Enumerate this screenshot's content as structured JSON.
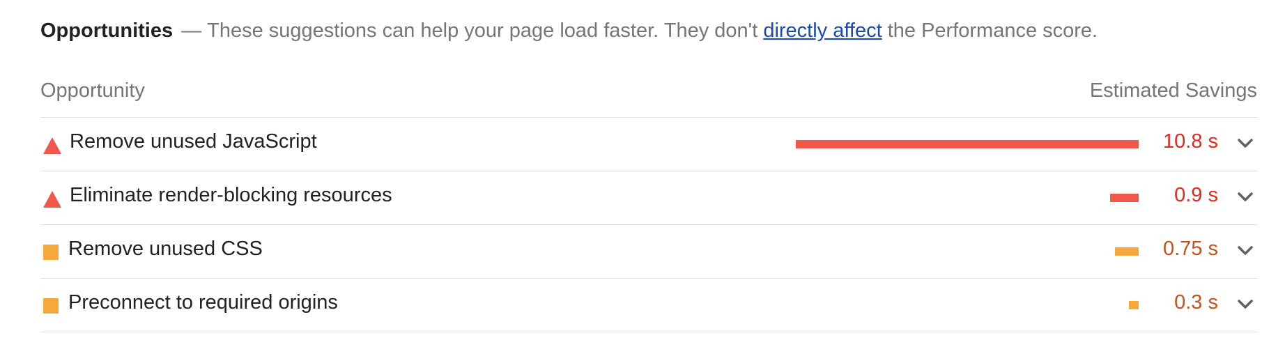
{
  "header": {
    "title": "Opportunities",
    "dash": "—",
    "desc_before": "These suggestions can help your page load faster. They don't",
    "link_text": "directly affect",
    "desc_after": "the Performance score."
  },
  "table": {
    "col_left": "Opportunity",
    "col_right": "Estimated Savings"
  },
  "colors": {
    "fail": "#f0584c",
    "fail_text": "#e6281c",
    "average": "#f5a93a",
    "average_text": "#c5521c"
  },
  "max_savings_s": 10.8,
  "rows": [
    {
      "label": "Remove unused JavaScript",
      "value": "10.8 s",
      "savings_s": 10.8,
      "severity": "fail",
      "icon": "triangle-warning-icon"
    },
    {
      "label": "Eliminate render-blocking resources",
      "value": "0.9 s",
      "savings_s": 0.9,
      "severity": "fail",
      "icon": "triangle-warning-icon"
    },
    {
      "label": "Remove unused CSS",
      "value": "0.75 s",
      "savings_s": 0.75,
      "severity": "average",
      "icon": "square-average-icon"
    },
    {
      "label": "Preconnect to required origins",
      "value": "0.3 s",
      "savings_s": 0.3,
      "severity": "average",
      "icon": "square-average-icon"
    }
  ]
}
